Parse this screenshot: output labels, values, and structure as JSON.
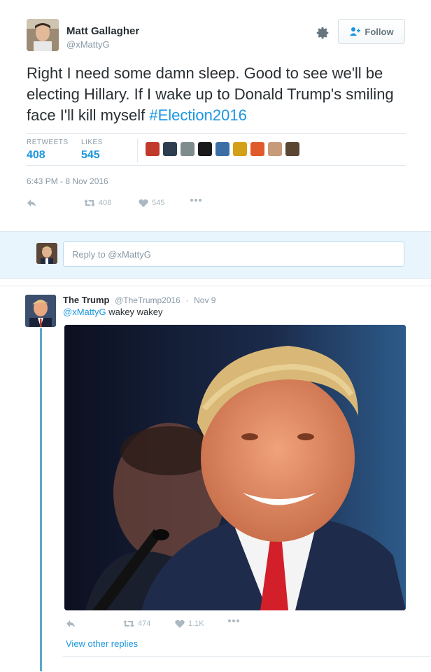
{
  "main_tweet": {
    "author_name": "Matt Gallagher",
    "author_handle": "@xMattyG",
    "follow_label": "Follow",
    "text_before": "Right I need some damn sleep. Good to see we'll be electing Hillary. If I wake up to Donald Trump's smiling face I'll kill myself ",
    "hashtag": "#Election2016",
    "stats": {
      "retweets_label": "RETWEETS",
      "retweets_value": "408",
      "likes_label": "LIKES",
      "likes_value": "545"
    },
    "liker_colors": [
      "#c0392b",
      "#2c3e50",
      "#7f8c8d",
      "#1a1a1a",
      "#3a6ea5",
      "#d4a017",
      "#e05a2b",
      "#c79a7a",
      "#5a4632"
    ],
    "timestamp": "6:43 PM - 8 Nov 2016",
    "actions": {
      "reply_icon": "reply-icon",
      "retweet_count": "408",
      "like_count": "545",
      "more_icon": "more-icon"
    }
  },
  "reply_box": {
    "placeholder": "Reply to @xMattyG"
  },
  "reply_tweet": {
    "author_name": "The Trump",
    "author_handle": "@TheTrump2016",
    "date": "Nov 9",
    "mention": "@xMattyG",
    "text": " wakey wakey",
    "actions": {
      "retweet_count": "474",
      "like_count": "1.1K"
    },
    "view_other_replies": "View other replies"
  },
  "colors": {
    "accent": "#1b95e0",
    "muted": "#8899a6",
    "reply_band": "#e8f5fd",
    "thread_line": "#5aa9c9"
  }
}
